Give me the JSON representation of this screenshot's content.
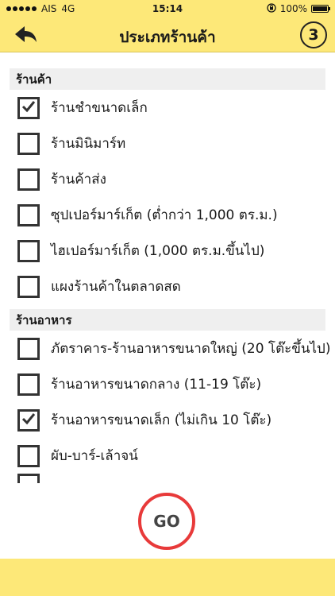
{
  "status_bar": {
    "carrier": "AIS",
    "network": "4G",
    "time": "15:14",
    "battery": "100%",
    "battery_level": 1.0
  },
  "nav": {
    "title": "ประเภทร้านค้า",
    "back_icon": "back-arrow-icon",
    "step": "3"
  },
  "sections": [
    {
      "title": "ร้านค้า",
      "items": [
        {
          "label": "ร้านชำขนาดเล็ก",
          "checked": true
        },
        {
          "label": "ร้านมินิมาร์ท",
          "checked": false
        },
        {
          "label": "ร้านค้าส่ง",
          "checked": false
        },
        {
          "label": "ซุปเปอร์มาร์เก็ต (ต่ำกว่า 1,000 ตร.ม.)",
          "checked": false
        },
        {
          "label": "ไฮเปอร์มาร์เก็ต (1,000 ตร.ม.ขึ้นไป)",
          "checked": false
        },
        {
          "label": "แผงร้านค้าในตลาดสด",
          "checked": false
        }
      ]
    },
    {
      "title": "ร้านอาหาร",
      "items": [
        {
          "label": "ภัตราคาร-ร้านอาหารขนาดใหญ่ (20 โต๊ะขึ้นไป)",
          "checked": false
        },
        {
          "label": "ร้านอาหารขนาดกลาง (11-19 โต๊ะ)",
          "checked": false
        },
        {
          "label": "ร้านอาหารขนาดเล็ก (ไม่เกิน 10 โต๊ะ)",
          "checked": true
        },
        {
          "label": "ผับ-บาร์-เล้าจน์",
          "checked": false
        }
      ]
    }
  ],
  "go_button": "GO",
  "colors": {
    "brand_yellow": "#fde878",
    "go_ring": "#e83a3a",
    "checkbox_border": "#333333"
  }
}
